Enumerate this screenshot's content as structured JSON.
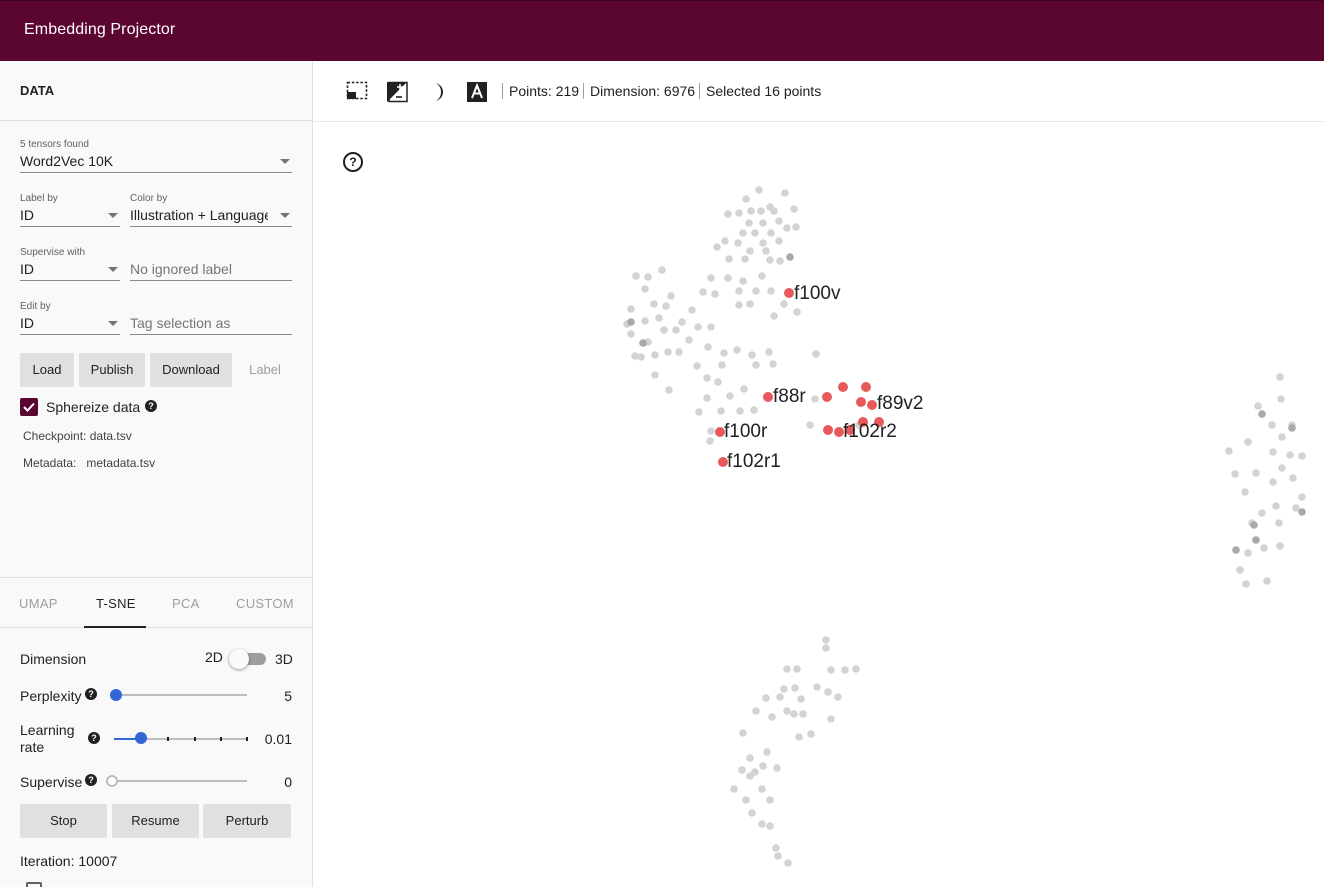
{
  "app": {
    "title": "Embedding Projector"
  },
  "data_panel": {
    "header": "DATA",
    "tensors": {
      "label": "5 tensors found",
      "value": "Word2Vec 10K"
    },
    "label_by": {
      "label": "Label by",
      "value": "ID"
    },
    "color_by": {
      "label": "Color by",
      "value": "Illustration + Language"
    },
    "supervise_with": {
      "label": "Supervise with",
      "value": "ID"
    },
    "ignored_label": {
      "placeholder": "No ignored label"
    },
    "edit_by": {
      "label": "Edit by",
      "value": "ID"
    },
    "tag_selection": {
      "placeholder": "Tag selection as"
    },
    "buttons": {
      "load": "Load",
      "publish": "Publish",
      "download": "Download",
      "label": "Label"
    },
    "sphereize": {
      "label": "Sphereize data",
      "checked": true
    },
    "checkpoint": {
      "label": "Checkpoint:",
      "value": "data.tsv"
    },
    "metadata": {
      "label": "Metadata:",
      "value": "metadata.tsv"
    }
  },
  "projection_tabs": [
    {
      "label": "UMAP",
      "active": false
    },
    {
      "label": "T-SNE",
      "active": true
    },
    {
      "label": "PCA",
      "active": false
    },
    {
      "label": "CUSTOM",
      "active": false
    }
  ],
  "tsne": {
    "dimension": {
      "label": "Dimension",
      "left": "2D",
      "right": "3D",
      "value": "2D"
    },
    "perplexity": {
      "label": "Perplexity",
      "value": "5",
      "fraction": 0.0
    },
    "learning_rate": {
      "label_line1": "Learning",
      "label_line2": "rate",
      "value": "0.01",
      "fraction": 0.2
    },
    "supervise": {
      "label": "Supervise",
      "value": "0",
      "fraction": 0.0
    },
    "buttons": {
      "stop": "Stop",
      "resume": "Resume",
      "perturb": "Perturb"
    },
    "iteration": "Iteration: 10007"
  },
  "toolbar": {
    "icons": [
      "select-box-icon",
      "night-mode-icon",
      "moon-icon",
      "label-toggle-icon"
    ],
    "points": "Points: 219",
    "dimension": "Dimension: 6976",
    "selected": "Selected 16 points"
  },
  "canvas": {
    "labels": [
      "f100v",
      "f88r",
      "f89v2",
      "f100r",
      "f102r2",
      "f102r1"
    ],
    "colors": {
      "selected": "#e8595c",
      "unselected": "#d3d3d3",
      "dark": "#a9a9a9",
      "accent": "#5a0630",
      "slider": "#3367d6"
    }
  }
}
